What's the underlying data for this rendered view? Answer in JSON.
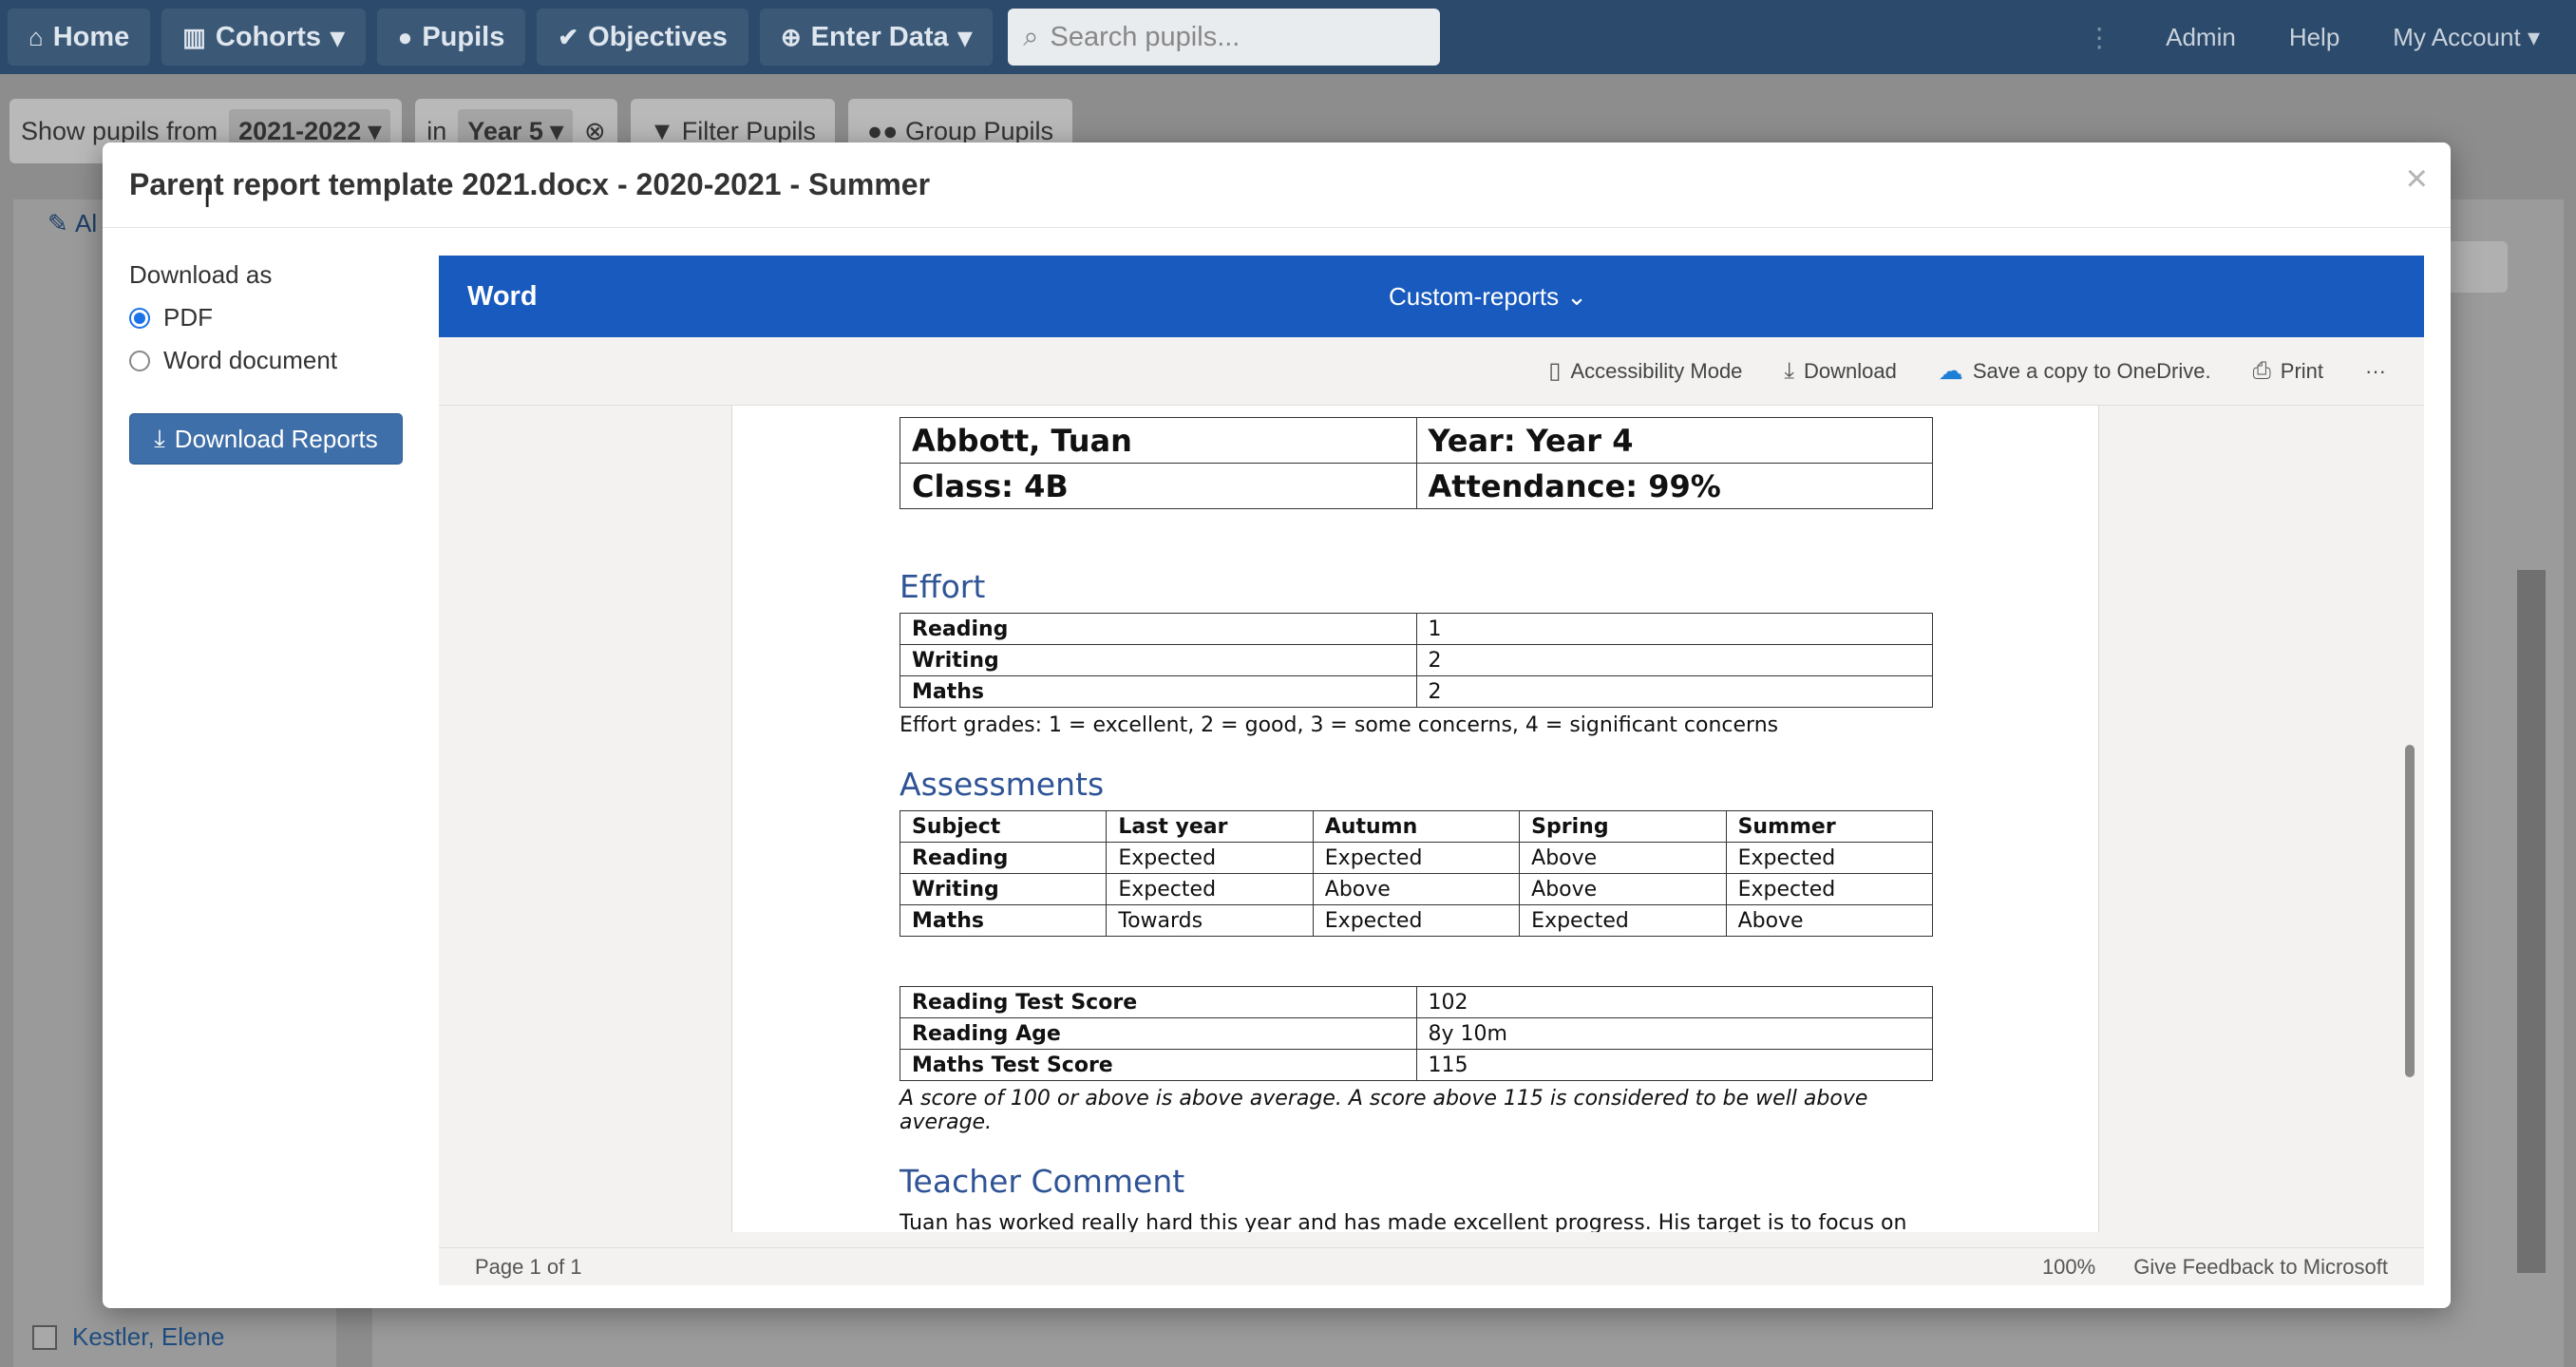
{
  "nav": {
    "items": [
      {
        "label": "Home",
        "icon": "home-icon",
        "glyph": "⌂",
        "caret": ""
      },
      {
        "label": "Cohorts",
        "icon": "bar-chart-icon",
        "glyph": "▥",
        "caret": "▾"
      },
      {
        "label": "Pupils",
        "icon": "user-icon",
        "glyph": "●",
        "caret": ""
      },
      {
        "label": "Objectives",
        "icon": "check-circle-icon",
        "glyph": "✔",
        "caret": ""
      },
      {
        "label": "Enter Data",
        "icon": "plus-circle-icon",
        "glyph": "⊕",
        "caret": "▾"
      }
    ],
    "search_placeholder": "Search pupils...",
    "admin": "Admin",
    "help": "Help",
    "account": "My Account"
  },
  "filters": {
    "show_label": "Show pupils from",
    "year_value": "2021-2022",
    "in_label": "in",
    "group_value": "Year 5",
    "filter_btn": "Filter Pupils",
    "group_btn": "Group Pupils"
  },
  "list": {
    "header": "Al",
    "last_visible": "Kestler, Elene"
  },
  "modal": {
    "title": "Parent report template 2021.docx - 2020-2021 - Summer",
    "close": "×",
    "download_as": "Download as",
    "options": [
      "PDF",
      "Word document"
    ],
    "selected": "PDF",
    "download_button": "Download Reports"
  },
  "viewer": {
    "brand": "Word",
    "folder": "Custom-reports",
    "toolbar": {
      "accessibility": "Accessibility Mode",
      "download": "Download",
      "onedrive": "Save a copy to OneDrive.",
      "print": "Print",
      "more": "···"
    },
    "footer": {
      "page": "Page 1 of 1",
      "zoom": "100%",
      "feedback": "Give Feedback to Microsoft"
    }
  },
  "doc": {
    "header": {
      "name": "Abbott, Tuan",
      "year": "Year: Year 4",
      "class": "Class: 4B",
      "attendance": "Attendance: 99%"
    },
    "effort_title": "Effort",
    "effort": [
      [
        "Reading",
        "1"
      ],
      [
        "Writing",
        "2"
      ],
      [
        "Maths",
        "2"
      ]
    ],
    "effort_note": "Effort grades: 1 = excellent, 2 = good, 3 = some concerns, 4 = significant concerns",
    "assess_title": "Assessments",
    "assess_headers": [
      "Subject",
      "Last year",
      "Autumn",
      "Spring",
      "Summer"
    ],
    "assess": [
      [
        "Reading",
        "Expected",
        "Expected",
        "Above",
        "Expected"
      ],
      [
        "Writing",
        "Expected",
        "Above",
        "Above",
        "Expected"
      ],
      [
        "Maths",
        "Towards",
        "Expected",
        "Expected",
        "Above"
      ]
    ],
    "scores": [
      [
        "Reading Test Score",
        "102"
      ],
      [
        "Reading Age",
        "8y 10m"
      ],
      [
        "Maths Test Score",
        "115"
      ]
    ],
    "score_note": "A score of 100 or above is above average. A score above 115 is considered to be well above average.",
    "comment_title": "Teacher Comment",
    "comment": "Tuan has worked really hard this year and has made excellent progress. His target is to focus on"
  }
}
